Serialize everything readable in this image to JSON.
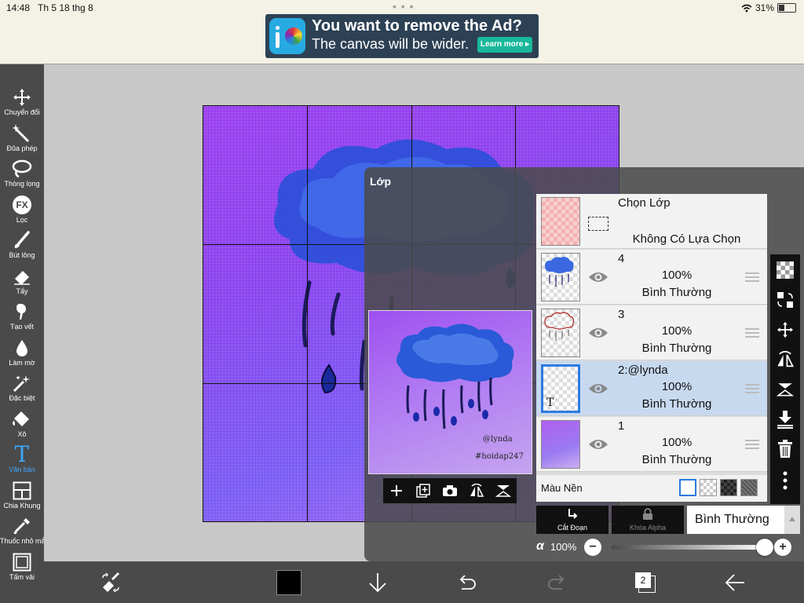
{
  "status": {
    "time": "14:48",
    "date": "Th 5 18 thg 8",
    "battery": "31%",
    "battery_level": 0.31
  },
  "ad": {
    "title": "You want to remove the Ad?",
    "subtitle": "The canvas will be wider.",
    "button": "Learn more"
  },
  "tools": [
    {
      "label": "Chuyển đổi",
      "icon": "move-icon"
    },
    {
      "label": "Đũa phép",
      "icon": "magic-wand-icon"
    },
    {
      "label": "Thòng lọng",
      "icon": "lasso-icon"
    },
    {
      "label": "Lọc",
      "icon": "fx-icon",
      "icon_text": "FX"
    },
    {
      "label": "Bút lông",
      "icon": "brush-icon"
    },
    {
      "label": "Tẩy",
      "icon": "eraser-icon"
    },
    {
      "label": "Tạo vết",
      "icon": "smudge-icon"
    },
    {
      "label": "Làm mờ",
      "icon": "blur-icon"
    },
    {
      "label": "Đặc biệt",
      "icon": "special-icon"
    },
    {
      "label": "Xô",
      "icon": "bucket-icon"
    },
    {
      "label": "Văn bản",
      "icon": "text-icon",
      "icon_text": "T",
      "active": true
    },
    {
      "label": "Chia Khung",
      "icon": "frame-divider-icon"
    },
    {
      "label": "Thuốc nhỏ mắt",
      "icon": "eyedropper-icon"
    },
    {
      "label": "Tấm vải",
      "icon": "canvas-icon"
    }
  ],
  "artwork": {
    "watermark_1": "@lynda",
    "watermark_2": "#hoidap247"
  },
  "layers_panel": {
    "title": "Lớp",
    "selection_layer": {
      "label": "Chọn Lớp",
      "status": "Không Có Lựa Chọn"
    },
    "layers": [
      {
        "name": "4",
        "opacity": "100%",
        "blend": "Bình Thường",
        "selected": false
      },
      {
        "name": "3",
        "opacity": "100%",
        "blend": "Bình Thường",
        "selected": false
      },
      {
        "name": "2:@lynda",
        "opacity": "100%",
        "blend": "Bình Thường",
        "selected": true,
        "thumb_text": "T"
      },
      {
        "name": "1",
        "opacity": "100%",
        "blend": "Bình Thường",
        "selected": false
      }
    ],
    "background": {
      "label": "Màu Nền"
    },
    "clipping_label": "Cắt Đoạn",
    "alpha_lock_label": "Khóa Alpha",
    "blend_mode": "Bình Thường",
    "alpha_symbol": "α",
    "alpha_value": "100%",
    "alpha_level": 1.0
  },
  "bottom": {
    "layer_count": "2"
  },
  "colors": {
    "toolbar": "#4a4a4a",
    "accent": "#3ea8ff",
    "selected_row": "#c7d9ef",
    "primary_color": "#000000"
  }
}
